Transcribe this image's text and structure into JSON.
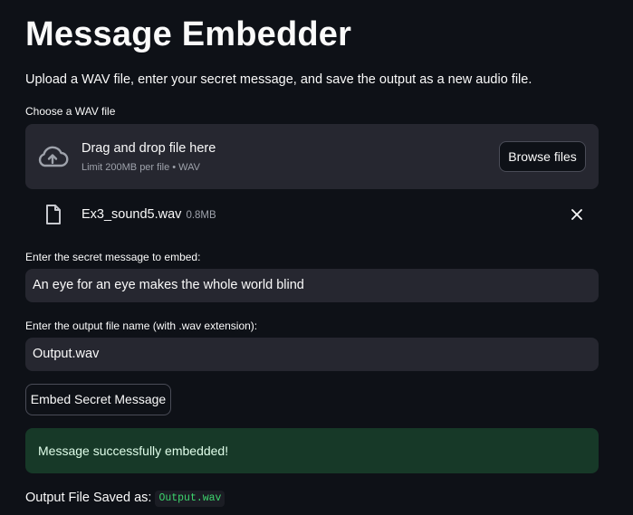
{
  "title": "Message Embedder",
  "subtitle": "Upload a WAV file, enter your secret message, and save the output as a new audio file.",
  "uploader": {
    "label": "Choose a WAV file",
    "dropzone_text": "Drag and drop file here",
    "limit_text": "Limit 200MB per file • WAV",
    "browse_label": "Browse files",
    "icon": "cloud-upload-icon"
  },
  "uploaded_file": {
    "name": "Ex3_sound5.wav",
    "size": "0.8MB",
    "icon": "file-icon",
    "remove_icon": "close-icon"
  },
  "message_input": {
    "label": "Enter the secret message to embed:",
    "value": "An eye for an eye makes the whole world blind"
  },
  "filename_input": {
    "label": "Enter the output file name (with .wav extension):",
    "value": "Output.wav"
  },
  "embed_button": {
    "label": "Embed Secret Message"
  },
  "success_alert": {
    "text": "Message successfully embedded!"
  },
  "output": {
    "label": "Output File Saved as:",
    "filename": "Output.wav"
  },
  "colors": {
    "background": "#0e1117",
    "surface": "#262730",
    "success_bg": "#173928",
    "success_text": "#dffde9",
    "code_text": "#3dd56d",
    "muted_text": "#9ea2ab"
  }
}
